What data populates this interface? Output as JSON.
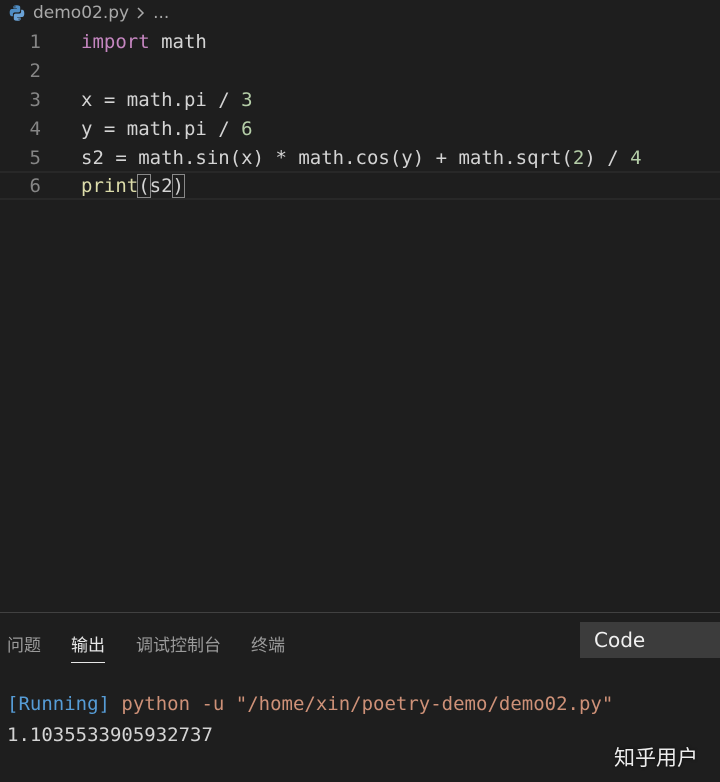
{
  "breadcrumb": {
    "file_icon": "python-icon",
    "file_name": "demo02.py",
    "separator_icon": "chevron-right-icon",
    "more": "..."
  },
  "editor": {
    "current_line": 6,
    "lines": [
      {
        "number": "1",
        "text": "import math"
      },
      {
        "number": "2",
        "text": ""
      },
      {
        "number": "3",
        "text": "x = math.pi / 3"
      },
      {
        "number": "4",
        "text": "y = math.pi / 6"
      },
      {
        "number": "5",
        "text": "s2 = math.sin(x) * math.cos(y) + math.sqrt(2) / 4"
      },
      {
        "number": "6",
        "text": "print(s2)"
      }
    ],
    "tokens": {
      "l1_kw": "import",
      "l1_rest": " math",
      "l3_a": "x = math.pi / ",
      "l3_num": "3",
      "l4_a": "y = math.pi / ",
      "l4_num": "6",
      "l5_a": "s2 = math.sin(x) * math.cos(y) + math.sqrt(",
      "l5_num1": "2",
      "l5_b": ") / ",
      "l5_num2": "4",
      "l6_fn": "print",
      "l6_open": "(",
      "l6_arg": "s2",
      "l6_close": ")"
    }
  },
  "panel": {
    "tabs": [
      {
        "label": "问题",
        "active": false
      },
      {
        "label": "输出",
        "active": true
      },
      {
        "label": "调试控制台",
        "active": false
      },
      {
        "label": "终端",
        "active": false
      }
    ],
    "output_channel": "Code",
    "output": {
      "running_tag": "[Running]",
      "command": " python -u \"/home/xin/poetry-demo/demo02.py\"",
      "result": "1.1035533905932737"
    }
  },
  "watermark": "知乎用户",
  "colors": {
    "background": "#1e1e1e",
    "keyword": "#c586c0",
    "function": "#dcdcaa",
    "number": "#b5cea8",
    "running": "#569cd6",
    "string": "#ce9178"
  }
}
